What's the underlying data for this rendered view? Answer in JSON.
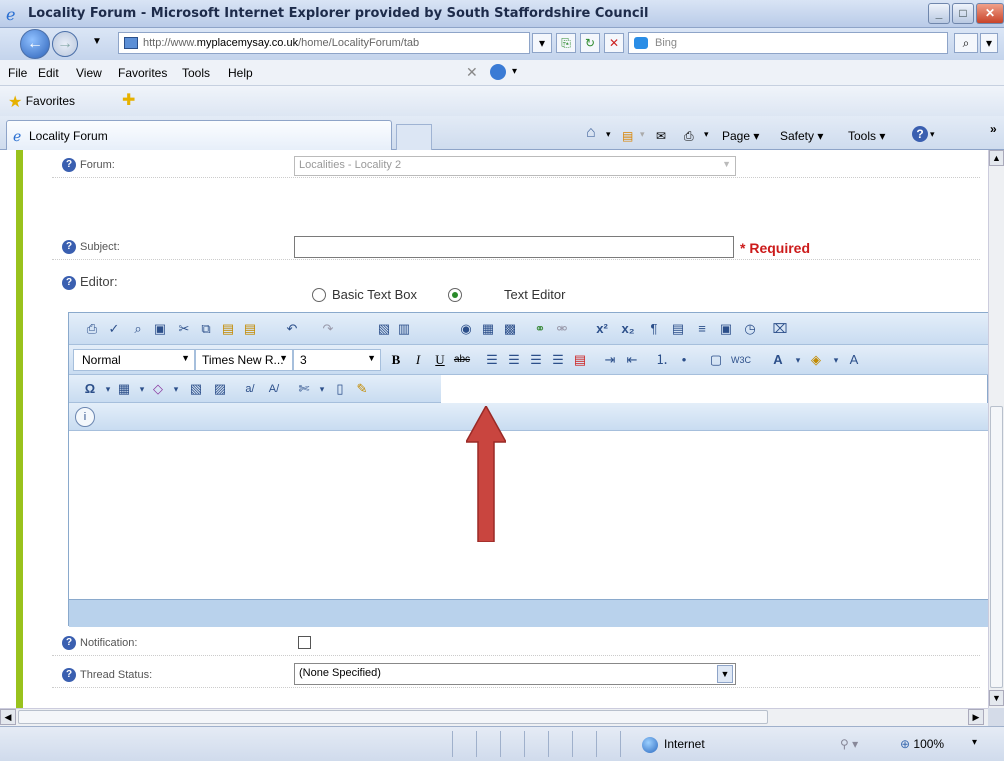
{
  "window": {
    "title": "Locality Forum - Microsoft Internet Explorer provided by South Staffordshire Council"
  },
  "address": {
    "url_prefix": "http://www.",
    "url_domain": "myplacemysay.co.uk",
    "url_path": "/home/LocalityForum/tab",
    "search_placeholder": "Bing"
  },
  "menu": [
    "File",
    "Edit",
    "View",
    "Favorites",
    "Tools",
    "Help"
  ],
  "favorites": {
    "label": "Favorites"
  },
  "tab": {
    "title": "Locality Forum"
  },
  "commands": {
    "page": "Page ▾",
    "safety": "Safety ▾",
    "tools": "Tools ▾"
  },
  "form": {
    "forum_label": "Forum:",
    "forum_value": "Localities - Locality 2",
    "subject_label": "Subject:",
    "subject_value": "",
    "required_text": "* Required",
    "editor_label": "Editor:",
    "editor_option_basic": "Basic Text Box",
    "editor_option_rich": "Text Editor",
    "format_select": "Normal",
    "font_select": "Times New R...",
    "size_select": "3",
    "notification_label": "Notification:",
    "thread_status_label": "Thread Status:",
    "thread_status_value": "(None Specified)"
  },
  "status": {
    "zone": "Internet",
    "zoom": "100%"
  },
  "colors": {
    "accent_green": "#99c21d",
    "required_red": "#cc1b1b",
    "annotation_arrow": "#c9453f"
  }
}
